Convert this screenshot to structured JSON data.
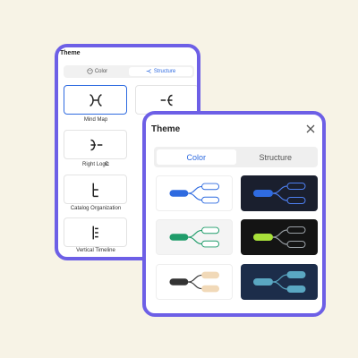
{
  "back_panel": {
    "title": "Theme",
    "tabs": [
      {
        "label": "Color",
        "icon": "palette-icon"
      },
      {
        "label": "Structure",
        "icon": "structure-icon"
      }
    ],
    "layouts": [
      {
        "label": "Mind Map",
        "icon": "mind-map-layout-icon",
        "selected": true
      },
      {
        "label": "",
        "icon": "left-logic-layout-icon",
        "selected": false
      },
      {
        "label": "Right Logic",
        "icon": "right-logic-layout-icon",
        "selected": false
      },
      {
        "label": "Catalog Organization",
        "icon": "catalog-organization-layout-icon",
        "selected": false
      },
      {
        "label": "Vertical Timeline",
        "icon": "vertical-timeline-layout-icon",
        "selected": false
      }
    ],
    "partial_label": "C"
  },
  "front_panel": {
    "title": "Theme",
    "close_icon": "close-icon",
    "tabs": [
      {
        "label": "Color",
        "active": true
      },
      {
        "label": "Structure",
        "active": false
      }
    ],
    "themes": [
      {
        "name": "blue-light",
        "background": "#ffffff",
        "root": "#2f6be0",
        "branch": "#2f6be0",
        "node_fill": "#ffffff",
        "node_stroke": "#2f6be0"
      },
      {
        "name": "blue-dark",
        "background": "#1a1f2e",
        "root": "#2f6be0",
        "branch": "#4d7ff0",
        "node_fill": "#1a1f2e",
        "node_stroke": "#4d7ff0"
      },
      {
        "name": "green-light",
        "background": "#f4f4f4",
        "root": "#1f9c6a",
        "branch": "#1f9c6a",
        "node_fill": "#ffffff",
        "node_stroke": "#1f9c6a"
      },
      {
        "name": "lime-dark",
        "background": "#141414",
        "root": "#a8e03a",
        "branch": "#9aa0a6",
        "node_fill": "#141414",
        "node_stroke": "#9aa0a6"
      },
      {
        "name": "tan-light",
        "background": "#ffffff",
        "root": "#333333",
        "branch": "#333333",
        "node_fill": "#f1d9b8",
        "node_stroke": "#f1d9b8"
      },
      {
        "name": "teal-navy",
        "background": "#1c2d4a",
        "root": "#5aa7c2",
        "branch": "#5aa7c2",
        "node_fill": "#5aa7c2",
        "node_stroke": "#5aa7c2"
      }
    ]
  },
  "colors": {
    "accent": "#2f6be0",
    "panel_border": "#6d5fe6",
    "page_background": "#f7f3e6"
  }
}
